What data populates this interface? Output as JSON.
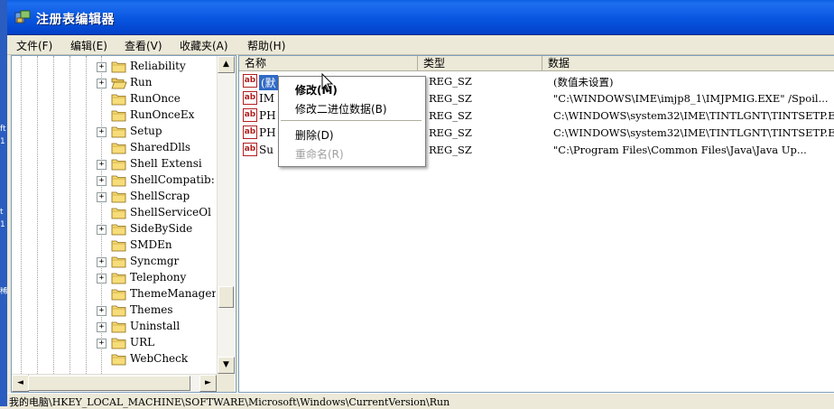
{
  "desktop": {
    "colors": {
      "background": "#2a5dbf"
    },
    "fragments": [
      "ft",
      "1",
      "t",
      "1",
      "稀"
    ]
  },
  "window": {
    "title": "注册表编辑器",
    "icon": "regedit-icon"
  },
  "menu": [
    "文件(F)",
    "编辑(E)",
    "查看(V)",
    "收藏夹(A)",
    "帮助(H)"
  ],
  "tree": {
    "items": [
      {
        "label": "Reliability",
        "expandable": true
      },
      {
        "label": "Run",
        "expandable": true,
        "open": true
      },
      {
        "label": "RunOnce",
        "expandable": false
      },
      {
        "label": "RunOnceEx",
        "expandable": false
      },
      {
        "label": "Setup",
        "expandable": true
      },
      {
        "label": "SharedDlls",
        "expandable": false
      },
      {
        "label": "Shell Extensi",
        "expandable": true
      },
      {
        "label": "ShellCompatib:",
        "expandable": true
      },
      {
        "label": "ShellScrap",
        "expandable": true
      },
      {
        "label": "ShellServiceOl",
        "expandable": false
      },
      {
        "label": "SideBySide",
        "expandable": true
      },
      {
        "label": "SMDEn",
        "expandable": false
      },
      {
        "label": "Syncmgr",
        "expandable": true
      },
      {
        "label": "Telephony",
        "expandable": true
      },
      {
        "label": "ThemeManager",
        "expandable": false
      },
      {
        "label": "Themes",
        "expandable": true
      },
      {
        "label": "Uninstall",
        "expandable": true
      },
      {
        "label": "URL",
        "expandable": true
      },
      {
        "label": "WebCheck",
        "expandable": false
      }
    ],
    "scroll": {
      "up": "▲",
      "down": "▼",
      "left": "◄",
      "right": "►"
    }
  },
  "list": {
    "columns": [
      "名称",
      "类型",
      "数据"
    ],
    "rows": [
      {
        "name": "(默",
        "type": "REG_SZ",
        "data": "(数值未设置)",
        "selected": true
      },
      {
        "name": "IM",
        "type": "REG_SZ",
        "data": "\"C:\\WINDOWS\\IME\\imjp8_1\\IMJPMIG.EXE\" /Spoil..."
      },
      {
        "name": "PH",
        "type": "REG_SZ",
        "data": "C:\\WINDOWS\\system32\\IME\\TINTLGNT\\TINTSETP.E..."
      },
      {
        "name": "PH",
        "type": "REG_SZ",
        "data": "C:\\WINDOWS\\system32\\IME\\TINTLGNT\\TINTSETP.E..."
      },
      {
        "name": "Su",
        "type": "REG_SZ",
        "data": "\"C:\\Program Files\\Common Files\\Java\\Java Up..."
      }
    ]
  },
  "context_menu": {
    "items": [
      {
        "label": "修改(M)",
        "bold": true
      },
      {
        "label": "修改二进位数据(B)"
      },
      {
        "label": "删除(D)"
      },
      {
        "label": "重命名(R)",
        "disabled": true
      }
    ]
  },
  "status": {
    "path": "我的电脑\\HKEY_LOCAL_MACHINE\\SOFTWARE\\Microsoft\\Windows\\CurrentVersion\\Run"
  },
  "colors": {
    "titlebar": "#0856e0",
    "selection": "#316ac5",
    "face": "#ece9d8"
  }
}
